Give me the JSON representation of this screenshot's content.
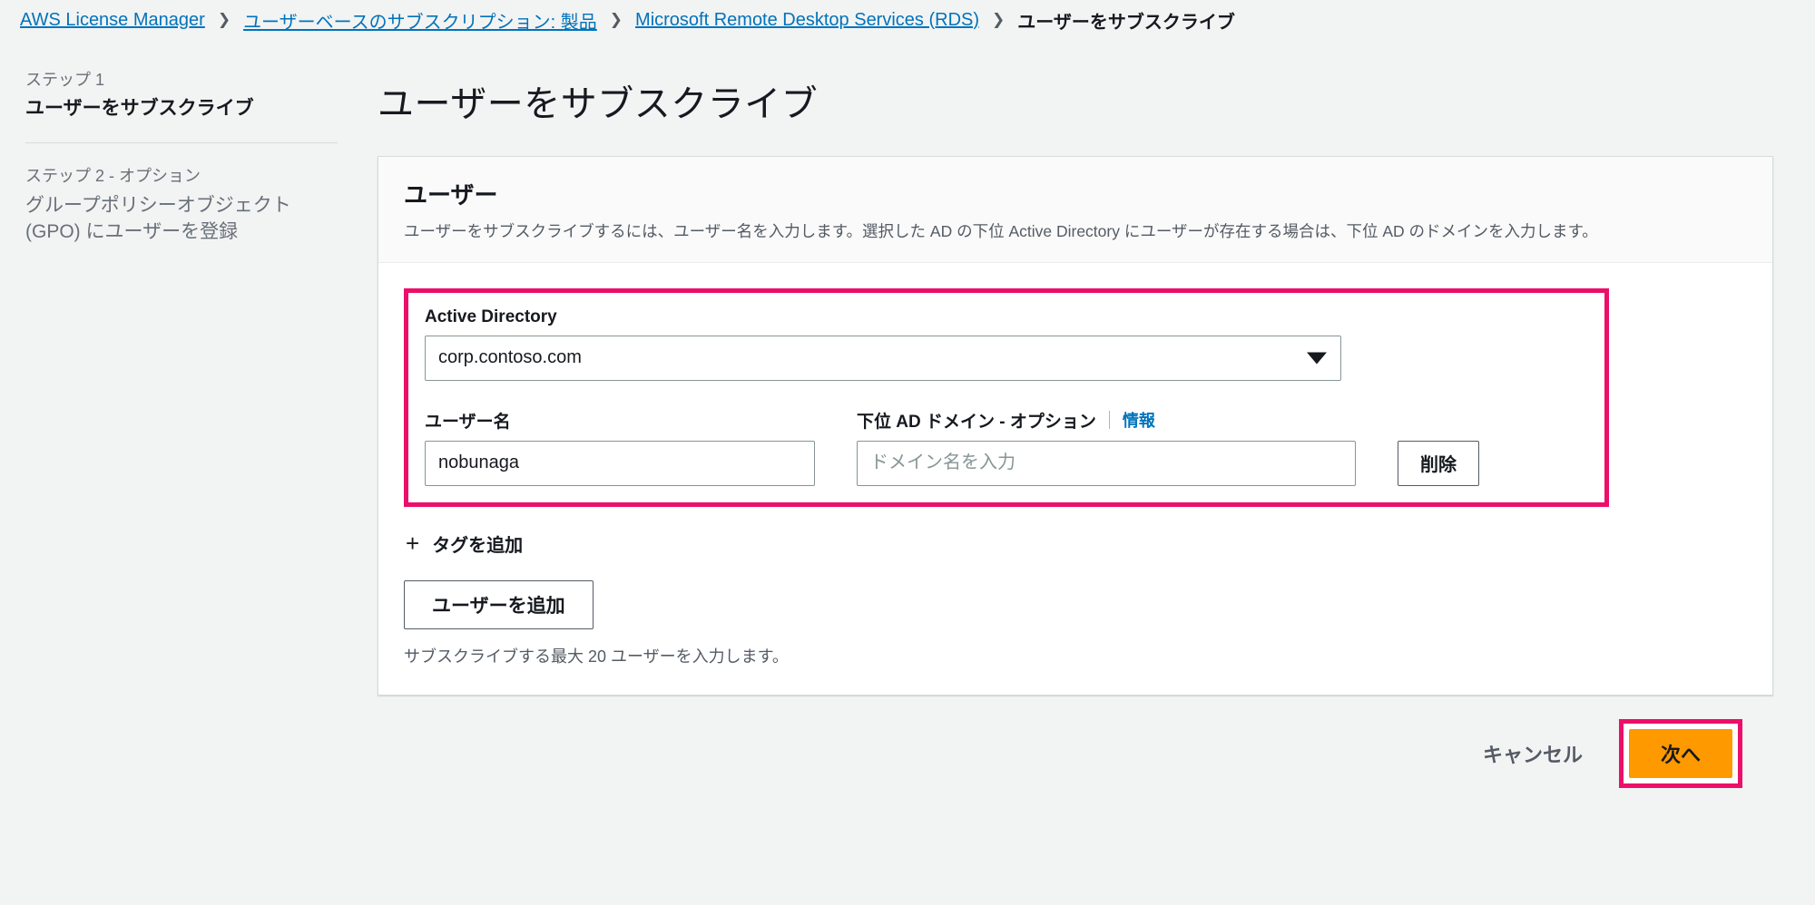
{
  "breadcrumb": {
    "items": [
      {
        "label": "AWS License Manager",
        "type": "link"
      },
      {
        "label": "ユーザーベースのサブスクリプション: 製品",
        "type": "link"
      },
      {
        "label": "Microsoft Remote Desktop Services (RDS)",
        "type": "link"
      },
      {
        "label": "ユーザーをサブスクライブ",
        "type": "current"
      }
    ],
    "separator": "❯"
  },
  "steps": [
    {
      "kicker": "ステップ 1",
      "title": "ユーザーをサブスクライブ",
      "active": true
    },
    {
      "kicker": "ステップ 2 - オプション",
      "title": "グループポリシーオブジェクト (GPO) にユーザーを登録",
      "active": false
    }
  ],
  "page_title": "ユーザーをサブスクライブ",
  "card": {
    "heading": "ユーザー",
    "description": "ユーザーをサブスクライブするには、ユーザー名を入力します。選択した AD の下位 Active Directory にユーザーが存在する場合は、下位 AD のドメインを入力します。",
    "active_directory": {
      "label": "Active Directory",
      "value": "corp.contoso.com",
      "caret_icon": "chevron-down-icon"
    },
    "username": {
      "label": "ユーザー名",
      "value": "nobunaga",
      "placeholder": ""
    },
    "child_domain": {
      "label": "下位 AD ドメイン - オプション",
      "info_label": "情報",
      "value": "",
      "placeholder": "ドメイン名を入力"
    },
    "remove_label": "削除",
    "add_tag": {
      "icon": "plus-icon",
      "label": "タグを追加"
    },
    "add_user_label": "ユーザーを追加",
    "hint": "サブスクライブする最大 20 ユーザーを入力します。"
  },
  "footer": {
    "cancel_label": "キャンセル",
    "next_label": "次へ"
  },
  "colors": {
    "page_background": "#f2f3f3",
    "link": "#0073bb",
    "annotation_highlight": "#ec0f69",
    "primary_button": "#ff9900",
    "border": "#d5dbdb",
    "muted_text": "#545b64"
  }
}
